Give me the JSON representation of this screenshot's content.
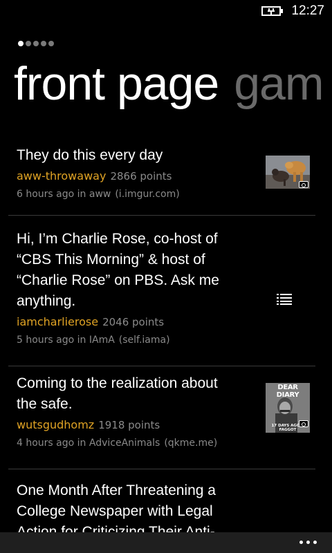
{
  "status": {
    "time": "12:27",
    "battery_icon": "battery-charging-icon"
  },
  "pivot": {
    "active_header": "front page",
    "next_header": "gam",
    "dot_count": 5,
    "active_dot": 0
  },
  "posts": [
    {
      "title": "They do this every day",
      "author": "aww-throwaway",
      "points": "2866 points",
      "time_sub": "6 hours ago in aww",
      "source": "(i.imgur.com)",
      "thumb_type": "image"
    },
    {
      "title": "Hi, I’m Charlie Rose, co-host of “CBS This Morning” & host of “Charlie Rose” on PBS. Ask me anything.",
      "author": "iamcharlierose",
      "points": "2046 points",
      "time_sub": "5 hours ago in IAmA",
      "source": "(self.iama)",
      "thumb_type": "self-text"
    },
    {
      "title": "Coming to the realization about the safe.",
      "author": "wutsgudhomz",
      "points": "1918 points",
      "time_sub": "4 hours ago in AdviceAnimals",
      "source": "(qkme.me)",
      "thumb_type": "image",
      "thumb_text_top": "DEAR DIARY",
      "thumb_text_bottom": "17 DAYS AGO, I FAGGOT"
    },
    {
      "title": "One Month After Threatening a College Newspaper with Legal Action for Criticizing Their Anti-"
    }
  ],
  "colors": {
    "accent": "#e0a324",
    "background": "#000000",
    "app_bar": "#1f1f1f"
  },
  "app_bar": {
    "more_icon": "more-options-icon"
  }
}
